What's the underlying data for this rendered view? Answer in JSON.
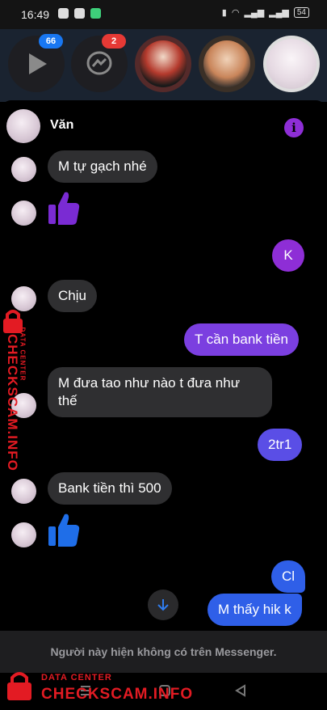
{
  "status_bar": {
    "time": "16:49",
    "battery": "54"
  },
  "chat_heads": [
    {
      "name": "play-app",
      "badge": "66",
      "badge_color": "#1877f2"
    },
    {
      "name": "messenger-app",
      "badge": "2",
      "badge_color": "#e53935"
    },
    {
      "name": "contact-1",
      "badge": ""
    },
    {
      "name": "contact-2",
      "badge": ""
    },
    {
      "name": "contact-3",
      "badge": ""
    }
  ],
  "chat": {
    "contact_name": "Văn",
    "messages": [
      {
        "side": "in",
        "text": "M tự gạch nhé"
      },
      {
        "side": "in",
        "type": "like"
      },
      {
        "side": "out",
        "text": "K"
      },
      {
        "side": "in",
        "text": "Chịu"
      },
      {
        "side": "out",
        "text": "T cần bank tiền"
      },
      {
        "side": "in",
        "text": "M đưa tao như nào t đưa như thế"
      },
      {
        "side": "out",
        "text": "2tr1"
      },
      {
        "side": "in",
        "text": "Bank tiền thì 500"
      },
      {
        "side": "in",
        "type": "like"
      },
      {
        "side": "out",
        "text": "Cl"
      },
      {
        "side": "out",
        "text": "M thấy hik k"
      }
    ],
    "footer_text": "Người này hiện không có trên Messenger."
  },
  "watermark": {
    "line1": "DATA CENTER",
    "line2": "CHECKSCAM.INFO",
    "color": "#e31b23"
  },
  "colors": {
    "purple": "#8e2ed6",
    "blue": "#2f5fe8",
    "like_in_purple": "#7a2bd3",
    "like_in_blue": "#1f6ee8"
  }
}
